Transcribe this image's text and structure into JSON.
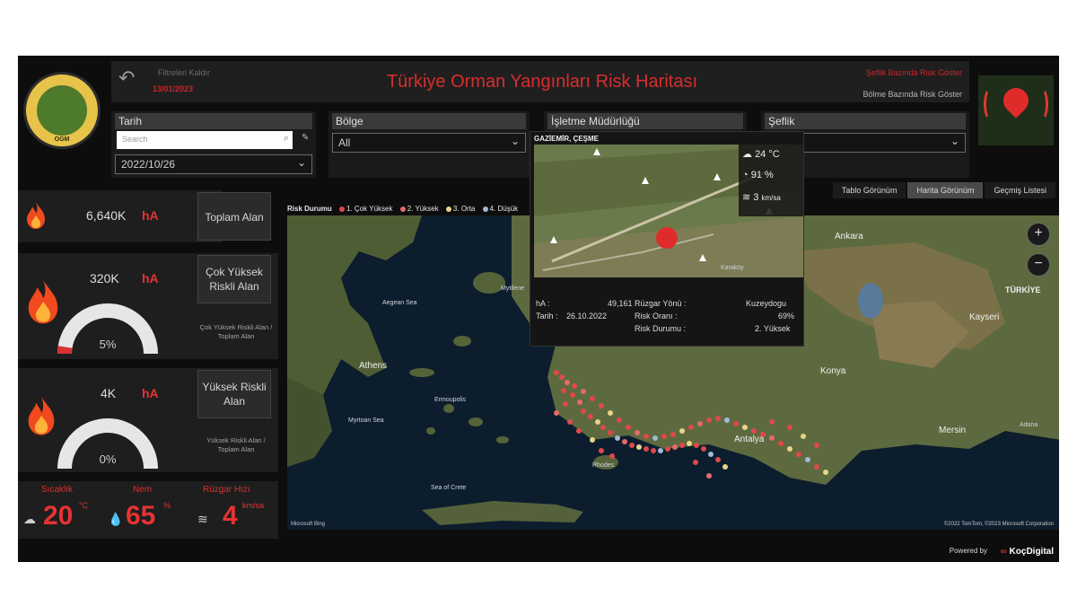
{
  "header": {
    "filters_label": "Filtreleri Kaldır",
    "filter_date": "13/01/2023",
    "title": "Türkiye Orman Yangınları Risk Haritası",
    "link_seflik": "Şeflik Bazında Risk Göster",
    "link_bolme": "Bölme Bazında Risk Göster"
  },
  "logo": {
    "text": "OGM",
    "year": "1839"
  },
  "filters": {
    "tarih": {
      "label": "Tarih",
      "search_placeholder": "Search",
      "value": "2022/10/26"
    },
    "bolge": {
      "label": "Bölge",
      "value": "All"
    },
    "isletme": {
      "label": "İşletme Müdürlüğü",
      "value": ""
    },
    "seflik": {
      "label": "Şeflik",
      "value": ""
    }
  },
  "cards": {
    "toplam": {
      "value": "6,640K",
      "unit": "hA",
      "button": "Toplam Alan"
    },
    "cok_yuksek": {
      "value": "320K",
      "unit": "hA",
      "button": "Çok Yüksek Riskli Alan",
      "gauge_pct": "5%",
      "gauge_fraction": 0.05,
      "note": "Çok Yüksek Riskli Alan / Toplam Alan"
    },
    "yuksek": {
      "value": "4K",
      "unit": "hA",
      "button": "Yüksek Riskli Alan",
      "gauge_pct": "0%",
      "gauge_fraction": 0.0,
      "note": "Yüksek Riskli Alan / Toplam Alan"
    }
  },
  "weather": {
    "sicaklik_label": "Sıcaklık",
    "sicaklik_value": "20",
    "sicaklik_unit": "°C",
    "nem_label": "Nem",
    "nem_value": "65",
    "nem_unit": "%",
    "ruzgar_label": "Rüzgar Hızı",
    "ruzgar_value": "4",
    "ruzgar_unit": "km/sa"
  },
  "view_tabs": [
    "Tablo Görünüm",
    "Harita Görünüm",
    "Geçmiş Listesi"
  ],
  "legend": {
    "title": "Risk Durumu",
    "items": [
      {
        "label": "1. Çok Yüksek",
        "color": "#e04848"
      },
      {
        "label": "2. Yüksek",
        "color": "#e86a6a"
      },
      {
        "label": "3. Orta",
        "color": "#e8d48a"
      },
      {
        "label": "4. Düşük",
        "color": "#9fb9d6"
      }
    ]
  },
  "map_labels": {
    "ankara": "Ankara",
    "turkiye": "TÜRKİYE",
    "kayseri": "Kayseri",
    "konya": "Konya",
    "mersin": "Mersin",
    "athens": "Athens",
    "antalya": "Antalya",
    "aegean": "Aegean Sea",
    "myrtoan": "Myrtoan Sea",
    "crete": "Sea of Crete",
    "rhodes": "Rhodes",
    "ermoupolis": "Ermoupolis",
    "mytilene": "Mytilene",
    "adana": "Adana"
  },
  "tooltip": {
    "title": "GAZİEMİR, ÇEŞME",
    "ha_label": "hA :",
    "ha_value": "49,161",
    "tarih_label": "Tarih :",
    "tarih_value": "26.10.2022",
    "ruzgar_label": "Rüzgar Yönü :",
    "ruzgar_value": "Kuzeydogu",
    "risk_orani_label": "Risk Oranı :",
    "risk_orani_value": "69%",
    "risk_durumu_label": "Risk Durumu :",
    "risk_durumu_value": "2. Yüksek",
    "temp": "24",
    "temp_unit": "°C",
    "humidity": "91",
    "humidity_unit": "%",
    "wind": "3",
    "wind_unit": "km/sa",
    "place": "Karaköy"
  },
  "map_copyright": "©2022 TomTom, ©2023 Microsoft Corporation",
  "map_bing": "Microsoft Bing",
  "footer": {
    "powered_by": "Powered by",
    "brand": "KoçDigital"
  },
  "colors": {
    "accent": "#e53333",
    "bg": "#0d0d0d",
    "panel": "#1e1e1e"
  }
}
